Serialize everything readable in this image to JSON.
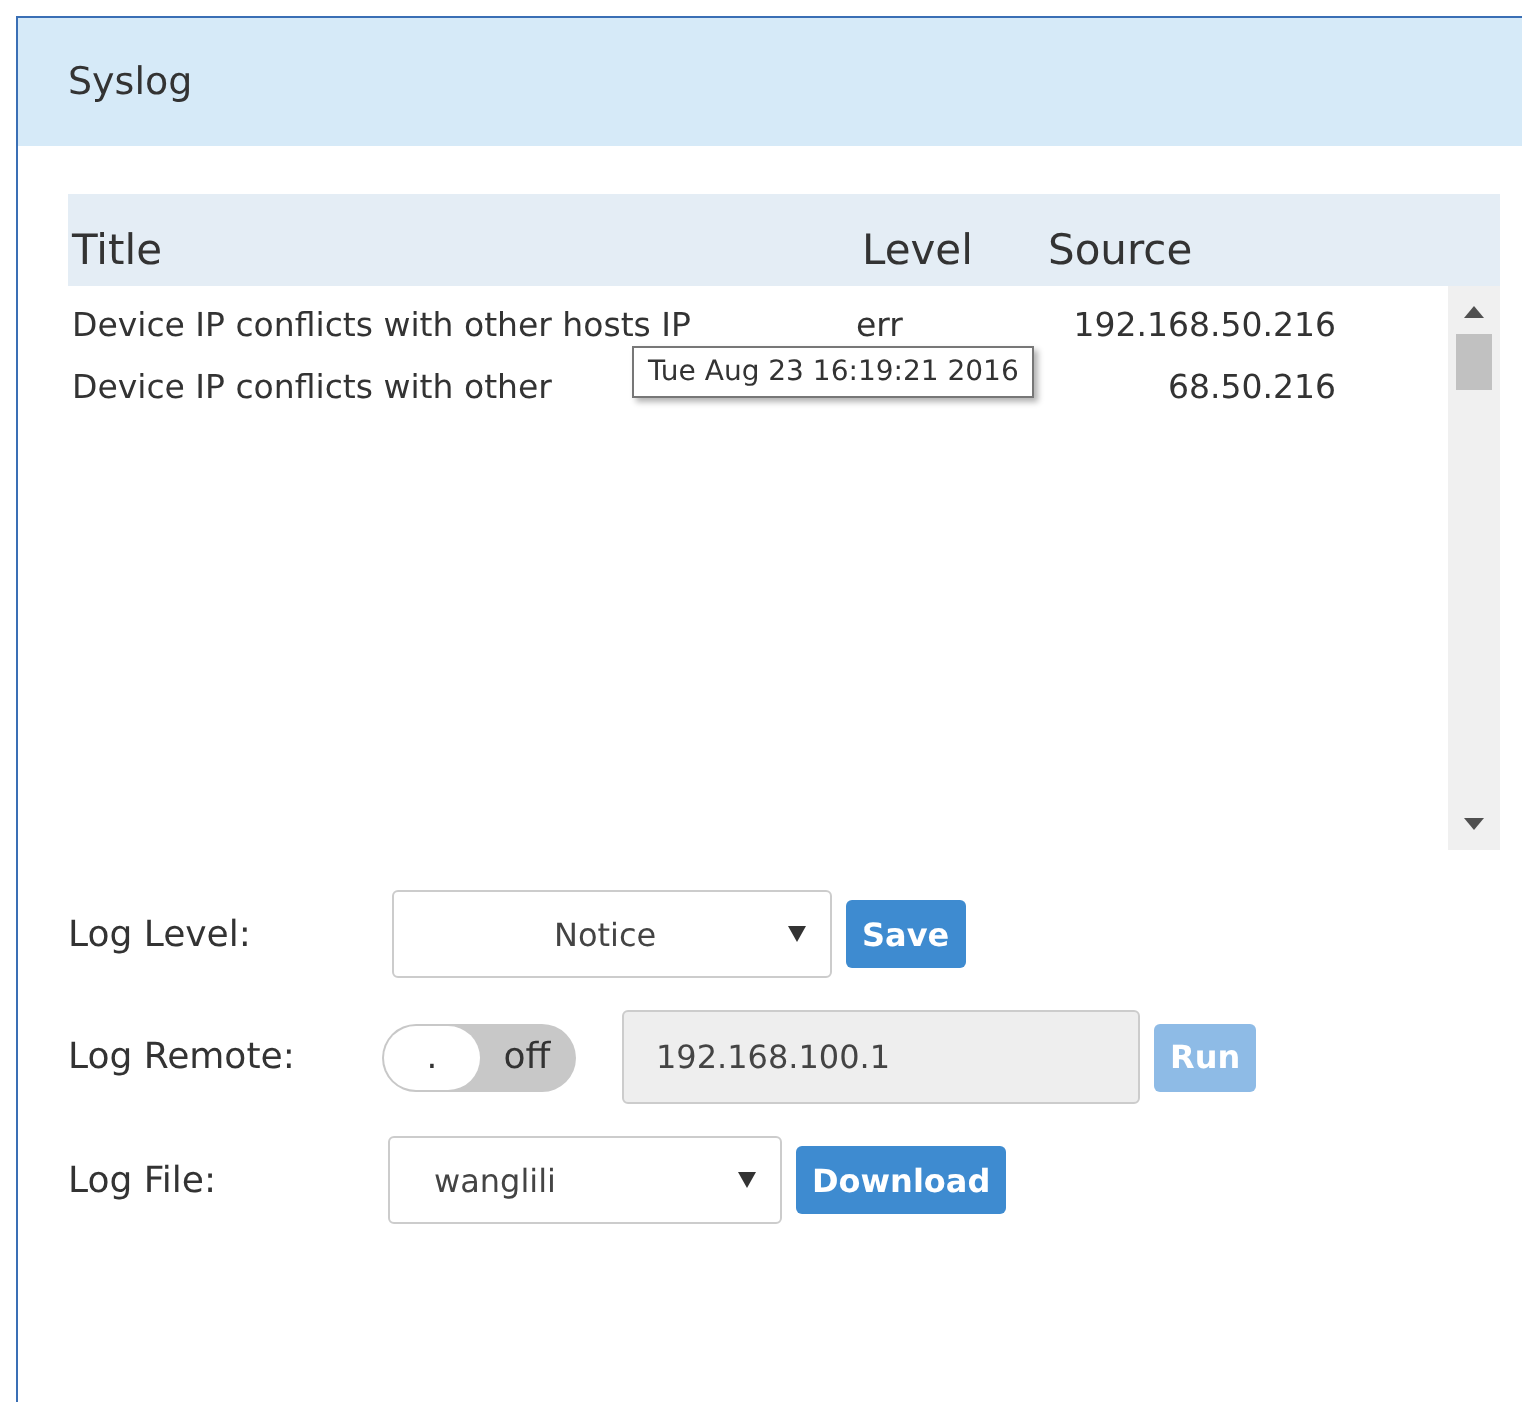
{
  "panel": {
    "title": "Syslog"
  },
  "table": {
    "columns": [
      "Title",
      "Level",
      "Source"
    ],
    "rows": [
      {
        "title": "Device IP conflicts with other hosts IP",
        "level": "err",
        "source": "192.168.50.216"
      },
      {
        "title": "Device IP conflicts with other",
        "level": "",
        "source": "68.50.216"
      }
    ],
    "tooltip": "Tue Aug 23 16:19:21 2016"
  },
  "form": {
    "log_level": {
      "label": "Log Level:",
      "value": "Notice",
      "button": "Save"
    },
    "log_remote": {
      "label": "Log Remote:",
      "toggle": {
        "on": false,
        "knob": ".",
        "text": "off"
      },
      "value": "192.168.100.1",
      "button": "Run",
      "button_disabled": true
    },
    "log_file": {
      "label": "Log File:",
      "value": "wanglili",
      "button": "Download"
    }
  }
}
